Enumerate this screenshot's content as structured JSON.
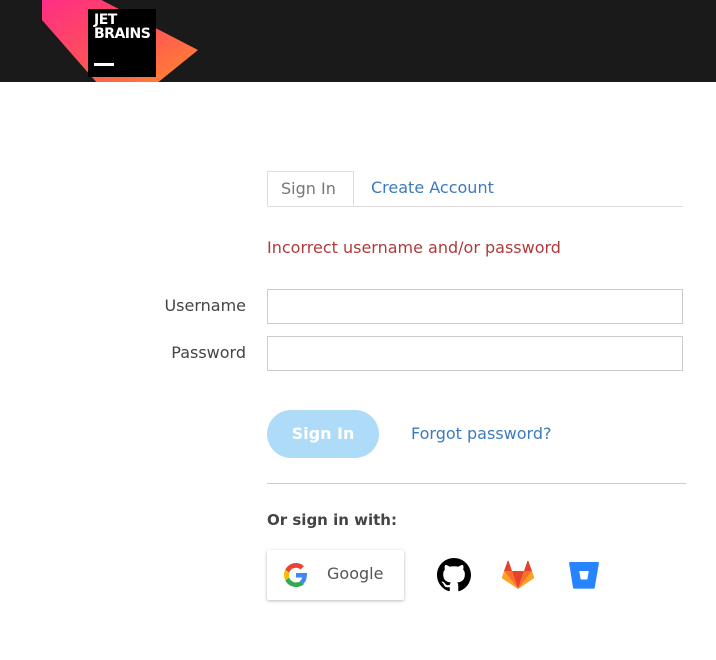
{
  "header": {
    "logo_text": "JET\nBRAINS",
    "background": "#1a1a1a"
  },
  "tabs": [
    {
      "label": "Sign In",
      "active": true
    },
    {
      "label": "Create Account",
      "active": false
    }
  ],
  "error_message": "Incorrect username and/or password",
  "form": {
    "username_label": "Username",
    "username_value": "",
    "password_label": "Password",
    "password_value": ""
  },
  "actions": {
    "signin_label": "Sign In",
    "forgot_label": "Forgot password?"
  },
  "social": {
    "heading": "Or sign in with:",
    "google_label": "Google",
    "providers": [
      {
        "icon": "github-icon"
      },
      {
        "icon": "gitlab-icon"
      },
      {
        "icon": "bitbucket-icon"
      }
    ]
  },
  "colors": {
    "error": "#b03a3a",
    "link": "#3a7bbf",
    "signin_button": "#aedcf8"
  }
}
